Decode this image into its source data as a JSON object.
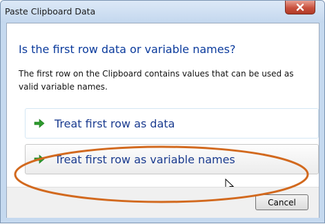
{
  "window": {
    "title": "Paste Clipboard Data"
  },
  "dialog": {
    "main_instruction": "Is the first row data or variable names?",
    "description": "The first row on the Clipboard contains values that can be used as valid variable names.",
    "options": [
      {
        "label": "Treat first row as data",
        "icon": "green-arrow-icon"
      },
      {
        "label": "Treat first row as variable names",
        "icon": "green-arrow-icon"
      }
    ],
    "cancel_label": "Cancel"
  },
  "colors": {
    "instruction": "#0a3a9c",
    "link": "#1a3b8f",
    "arrow": "#2e9a2e",
    "highlight_ring": "#d2691e",
    "close_button": "#c9513e"
  }
}
